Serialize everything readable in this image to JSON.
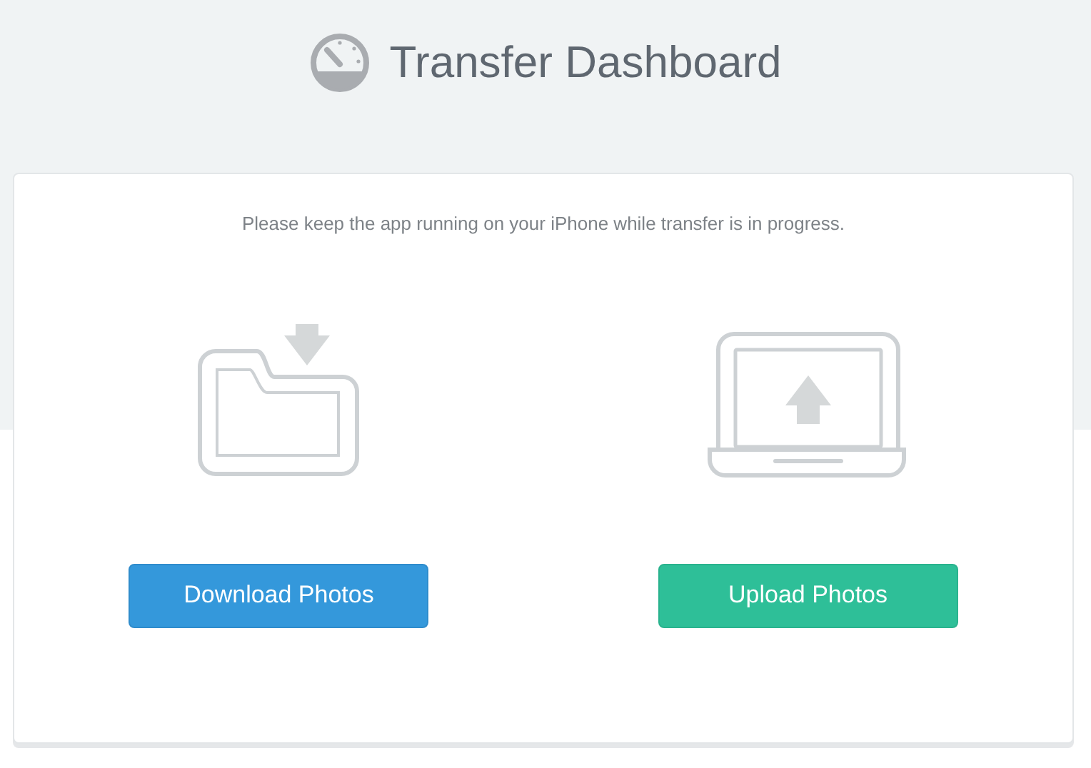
{
  "header": {
    "title": "Transfer Dashboard"
  },
  "notice": "Please keep the app running on your iPhone while transfer is in progress.",
  "actions": [
    {
      "kind": "download",
      "label": "Download Photos"
    },
    {
      "kind": "upload",
      "label": "Upload Photos"
    }
  ]
}
